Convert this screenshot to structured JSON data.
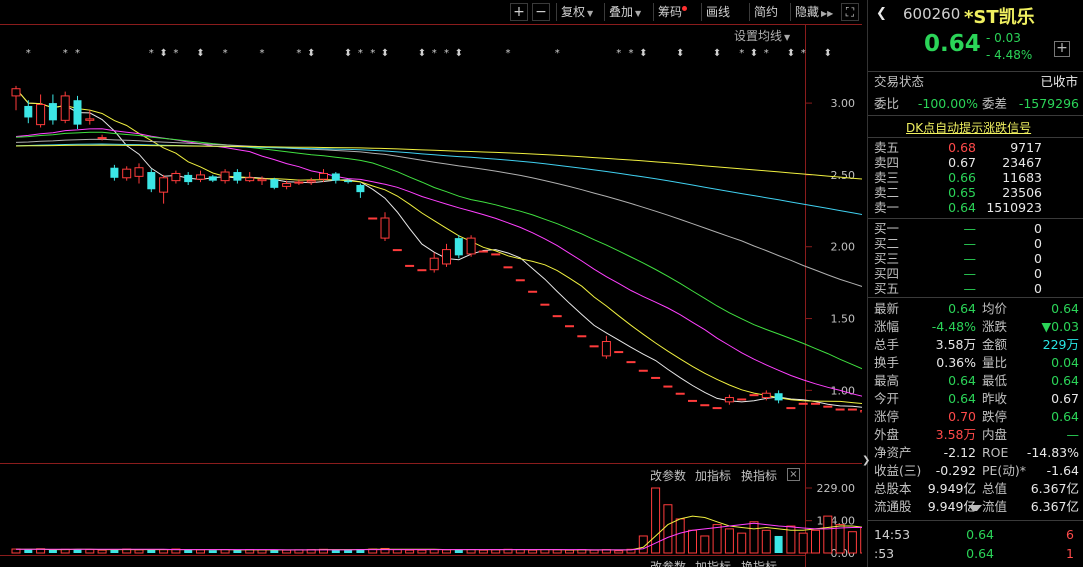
{
  "toolbar": {
    "plus": "+",
    "minus": "−",
    "restore_rights": "复权",
    "overlay": "叠加",
    "chips": "筹码",
    "draw_line": "画线",
    "brief": "简约",
    "hide": "隐藏",
    "expand": "⛶"
  },
  "settings_ma": "设置均线",
  "yaxis": [
    "3.00",
    "2.50",
    "2.00",
    "1.50",
    "1.00"
  ],
  "last_price_label": "0.64",
  "volume_axis": [
    "229.00",
    "114.00",
    "0.00"
  ],
  "indicator_controls": {
    "edit": "改参数",
    "add": "加指标",
    "swap": "换指标",
    "close": "×"
  },
  "indicator_controls_bottom": {
    "edit": "改参数",
    "add": "加指标",
    "swap": "换指标"
  },
  "header": {
    "code": "600260",
    "name": "*ST凯乐",
    "price": "0.64",
    "change": "- 0.03",
    "change_pct": "- 4.48%",
    "add": "+"
  },
  "status": {
    "label": "交易状态",
    "value": "已收市"
  },
  "committee": {
    "ratio_label": "委比",
    "ratio": "-100.00%",
    "diff_label": "委差",
    "diff": "-1579296"
  },
  "dk_link": "DK点自动提示涨跌信号",
  "asks": [
    {
      "label": "卖五",
      "price": "0.68",
      "volume": "9717",
      "color": "#ff4a4a"
    },
    {
      "label": "卖四",
      "price": "0.67",
      "volume": "23467",
      "color": "#e8e8e8"
    },
    {
      "label": "卖三",
      "price": "0.66",
      "volume": "11683",
      "color": "#2bd458"
    },
    {
      "label": "卖二",
      "price": "0.65",
      "volume": "23506",
      "color": "#2bd458"
    },
    {
      "label": "卖一",
      "price": "0.64",
      "volume": "1510923",
      "color": "#2bd458"
    }
  ],
  "bids": [
    {
      "label": "买一",
      "price": "—",
      "volume": "0"
    },
    {
      "label": "买二",
      "price": "—",
      "volume": "0"
    },
    {
      "label": "买三",
      "price": "—",
      "volume": "0"
    },
    {
      "label": "买四",
      "price": "—",
      "volume": "0"
    },
    {
      "label": "买五",
      "price": "—",
      "volume": "0"
    }
  ],
  "stats": [
    {
      "l1": "最新",
      "v1": "0.64",
      "c1": "#2bd458",
      "l2": "均价",
      "v2": "0.64",
      "c2": "#2bd458"
    },
    {
      "l1": "涨幅",
      "v1": "-4.48%",
      "c1": "#2bd458",
      "l2": "涨跌",
      "v2": "▼0.03",
      "c2": "#2bd458"
    },
    {
      "l1": "总手",
      "v1": "3.58万",
      "c1": "#e8e8e8",
      "l2": "金额",
      "v2": "229万",
      "c2": "#29e5e5"
    },
    {
      "l1": "换手",
      "v1": "0.36%",
      "c1": "#e8e8e8",
      "l2": "量比",
      "v2": "0.04",
      "c2": "#2bd458"
    },
    {
      "l1": "最高",
      "v1": "0.64",
      "c1": "#2bd458",
      "l2": "最低",
      "v2": "0.64",
      "c2": "#2bd458"
    },
    {
      "l1": "今开",
      "v1": "0.64",
      "c1": "#2bd458",
      "l2": "昨收",
      "v2": "0.67",
      "c2": "#e8e8e8"
    },
    {
      "l1": "涨停",
      "v1": "0.70",
      "c1": "#ff4a4a",
      "l2": "跌停",
      "v2": "0.64",
      "c2": "#2bd458"
    },
    {
      "l1": "外盘",
      "v1": "3.58万",
      "c1": "#ff4a4a",
      "l2": "内盘",
      "v2": "—",
      "c2": "#2bd458"
    },
    {
      "l1": "净资产",
      "v1": "-2.12",
      "c1": "#e8e8e8",
      "l2": "ROE",
      "v2": "-14.83%",
      "c2": "#e8e8e8"
    },
    {
      "l1": "收益(三)",
      "v1": "-0.292",
      "c1": "#e8e8e8",
      "l2": "PE(动)*",
      "v2": "-1.64",
      "c2": "#e8e8e8"
    },
    {
      "l1": "总股本",
      "v1": "9.949亿",
      "c1": "#e8e8e8",
      "l2": "总值",
      "v2": "6.367亿",
      "c2": "#e8e8e8"
    },
    {
      "l1": "流通股",
      "v1": "9.949亿",
      "c1": "#e8e8e8",
      "l2": "流值",
      "v2": "6.367亿",
      "c2": "#e8e8e8"
    }
  ],
  "ticks": [
    {
      "time": "14:53",
      "price": "0.64",
      "vol": "6"
    },
    {
      "time": ":53",
      "price": "0.64",
      "vol": "1"
    }
  ],
  "chart_data": {
    "type": "candlestick",
    "ylim": [
      0.55,
      3.3
    ],
    "candles": [
      [
        3.05,
        3.1,
        3.12,
        2.95
      ],
      [
        2.98,
        2.9,
        3.02,
        2.86
      ],
      [
        2.85,
        2.99,
        3.06,
        2.83
      ],
      [
        3.0,
        2.88,
        3.06,
        2.85
      ],
      [
        2.88,
        3.05,
        3.08,
        2.86
      ],
      [
        3.02,
        2.85,
        3.05,
        2.82
      ],
      [
        2.88,
        2.89,
        2.95,
        2.85
      ],
      [
        2.76,
        2.76,
        2.78,
        2.74
      ],
      [
        2.55,
        2.48,
        2.57,
        2.46
      ],
      [
        2.48,
        2.54,
        2.56,
        2.46
      ],
      [
        2.49,
        2.55,
        2.58,
        2.44
      ],
      [
        2.52,
        2.4,
        2.54,
        2.38
      ],
      [
        2.38,
        2.48,
        2.5,
        2.3
      ],
      [
        2.46,
        2.51,
        2.53,
        2.44
      ],
      [
        2.5,
        2.45,
        2.52,
        2.43
      ],
      [
        2.47,
        2.5,
        2.53,
        2.45
      ],
      [
        2.49,
        2.46,
        2.5,
        2.45
      ],
      [
        2.46,
        2.52,
        2.54,
        2.44
      ],
      [
        2.52,
        2.46,
        2.54,
        2.44
      ],
      [
        2.46,
        2.48,
        2.52,
        2.45
      ],
      [
        2.46,
        2.47,
        2.49,
        2.43
      ],
      [
        2.47,
        2.41,
        2.48,
        2.4
      ],
      [
        2.42,
        2.44,
        2.46,
        2.4
      ],
      [
        2.45,
        2.45,
        2.47,
        2.43
      ],
      [
        2.45,
        2.46,
        2.48,
        2.43
      ],
      [
        2.47,
        2.51,
        2.54,
        2.45
      ],
      [
        2.51,
        2.46,
        2.52,
        2.44
      ],
      [
        2.46,
        2.45,
        2.47,
        2.44
      ],
      [
        2.43,
        2.38,
        2.44,
        2.34
      ],
      [
        2.2,
        2.2,
        2.2,
        2.2
      ],
      [
        2.06,
        2.2,
        2.24,
        2.04
      ],
      [
        1.98,
        1.98,
        1.98,
        1.98
      ],
      [
        1.87,
        1.87,
        1.87,
        1.87
      ],
      [
        1.84,
        1.84,
        1.84,
        1.84
      ],
      [
        1.84,
        1.92,
        1.96,
        1.82
      ],
      [
        1.88,
        1.98,
        2.02,
        1.86
      ],
      [
        2.06,
        1.94,
        2.08,
        1.92
      ],
      [
        1.95,
        2.06,
        2.08,
        1.93
      ],
      [
        1.97,
        1.97,
        1.97,
        1.97
      ],
      [
        1.95,
        1.95,
        1.95,
        1.95
      ],
      [
        1.86,
        1.86,
        1.86,
        1.86
      ],
      [
        1.77,
        1.77,
        1.77,
        1.77
      ],
      [
        1.69,
        1.69,
        1.69,
        1.69
      ],
      [
        1.6,
        1.6,
        1.6,
        1.6
      ],
      [
        1.52,
        1.52,
        1.52,
        1.52
      ],
      [
        1.45,
        1.45,
        1.45,
        1.45
      ],
      [
        1.38,
        1.38,
        1.38,
        1.38
      ],
      [
        1.31,
        1.31,
        1.31,
        1.31
      ],
      [
        1.24,
        1.34,
        1.38,
        1.22
      ],
      [
        1.27,
        1.27,
        1.27,
        1.27
      ],
      [
        1.2,
        1.2,
        1.2,
        1.2
      ],
      [
        1.14,
        1.14,
        1.14,
        1.14
      ],
      [
        1.09,
        1.09,
        1.09,
        1.09
      ],
      [
        1.03,
        1.03,
        1.03,
        1.03
      ],
      [
        0.98,
        0.98,
        0.98,
        0.98
      ],
      [
        0.93,
        0.93,
        0.93,
        0.93
      ],
      [
        0.9,
        0.9,
        0.9,
        0.9
      ],
      [
        0.88,
        0.88,
        0.88,
        0.88
      ],
      [
        0.92,
        0.95,
        0.97,
        0.9
      ],
      [
        0.94,
        0.94,
        0.94,
        0.94
      ],
      [
        0.97,
        0.97,
        0.97,
        0.97
      ],
      [
        0.95,
        0.98,
        1.0,
        0.93
      ],
      [
        0.98,
        0.93,
        1.0,
        0.91
      ],
      [
        0.88,
        0.88,
        0.88,
        0.88
      ],
      [
        0.91,
        0.91,
        0.91,
        0.91
      ],
      [
        0.91,
        0.91,
        0.91,
        0.91
      ],
      [
        0.89,
        0.89,
        0.89,
        0.89
      ],
      [
        0.87,
        0.87,
        0.87,
        0.87
      ],
      [
        0.87,
        0.87,
        0.87,
        0.87
      ],
      [
        0.85,
        0.86,
        0.87,
        0.84
      ],
      [
        0.86,
        0.82,
        0.87,
        0.81
      ],
      [
        0.82,
        0.82,
        0.82,
        0.82
      ],
      [
        0.78,
        0.78,
        0.78,
        0.78
      ],
      [
        0.75,
        0.75,
        0.75,
        0.75
      ],
      [
        0.72,
        0.72,
        0.72,
        0.72
      ],
      [
        0.69,
        0.69,
        0.69,
        0.69
      ],
      [
        0.72,
        0.72,
        0.74,
        0.7
      ],
      [
        0.7,
        0.7,
        0.7,
        0.7
      ],
      [
        0.67,
        0.67,
        0.67,
        0.67
      ],
      [
        0.64,
        0.64,
        0.64,
        0.64
      ]
    ],
    "volume_ylim": [
      0,
      229
    ],
    "volumes": [
      14,
      12,
      15,
      11,
      13,
      13,
      12,
      10,
      12,
      14,
      11,
      13,
      12,
      14,
      12,
      11,
      10,
      12,
      11,
      12,
      11,
      12,
      10,
      11,
      12,
      13,
      12,
      11,
      14,
      14,
      16,
      12,
      10,
      10,
      12,
      11,
      13,
      12,
      10,
      11,
      13,
      12,
      10,
      12,
      11,
      10,
      12,
      10,
      12,
      8,
      13,
      60,
      229,
      170,
      120,
      80,
      60,
      100,
      85,
      70,
      110,
      80,
      60,
      95,
      70,
      80,
      130,
      100,
      75,
      90,
      85,
      65,
      110,
      90,
      80,
      95,
      82,
      70,
      100,
      90
    ],
    "vol_ma5": [
      13,
      13,
      13,
      12,
      12,
      13,
      13,
      12,
      12,
      12,
      12,
      12,
      12,
      12,
      12,
      12,
      12,
      12,
      11,
      11,
      11,
      11,
      11,
      11,
      11,
      12,
      12,
      12,
      12,
      13,
      13,
      13,
      13,
      13,
      13,
      12,
      12,
      12,
      12,
      12,
      12,
      12,
      12,
      12,
      12,
      11,
      11,
      11,
      11,
      11,
      11,
      20,
      60,
      100,
      120,
      130,
      125,
      110,
      95,
      90,
      85,
      90,
      85,
      80,
      80,
      85,
      90,
      95,
      95,
      90,
      85,
      85,
      88,
      90,
      90,
      90,
      88,
      86,
      85,
      78
    ],
    "vol_ma10": [
      13,
      13,
      13,
      13,
      13,
      13,
      13,
      13,
      13,
      13,
      13,
      13,
      13,
      12,
      12,
      12,
      12,
      12,
      12,
      12,
      12,
      12,
      11,
      11,
      11,
      11,
      11,
      11,
      12,
      12,
      12,
      12,
      12,
      12,
      12,
      12,
      12,
      12,
      12,
      12,
      12,
      12,
      12,
      12,
      12,
      12,
      12,
      11,
      11,
      11,
      11,
      15,
      35,
      55,
      70,
      80,
      85,
      90,
      95,
      100,
      105,
      100,
      95,
      92,
      88,
      85,
      85,
      88,
      90,
      90,
      88,
      86,
      86,
      86,
      87,
      88,
      88,
      88,
      86,
      84
    ],
    "marks": [
      1,
      4,
      5,
      11,
      12,
      13,
      15,
      17,
      20,
      23,
      24,
      27,
      28,
      29,
      30,
      33,
      34,
      35,
      36,
      40,
      44,
      49,
      50,
      51,
      54,
      57,
      59,
      60,
      61,
      63,
      64,
      66
    ],
    "ma_lines": [
      {
        "name": "MA5",
        "color": "#e8e8e8"
      },
      {
        "name": "MA10",
        "color": "#f0f040"
      },
      {
        "name": "MA20",
        "color": "#ff40ff"
      },
      {
        "name": "MA30",
        "color": "#40e040"
      },
      {
        "name": "MA60",
        "color": "#b0b0b0"
      },
      {
        "name": "MA120",
        "color": "#40d0f0"
      },
      {
        "name": "MA250",
        "color": "#f0f040"
      }
    ]
  }
}
